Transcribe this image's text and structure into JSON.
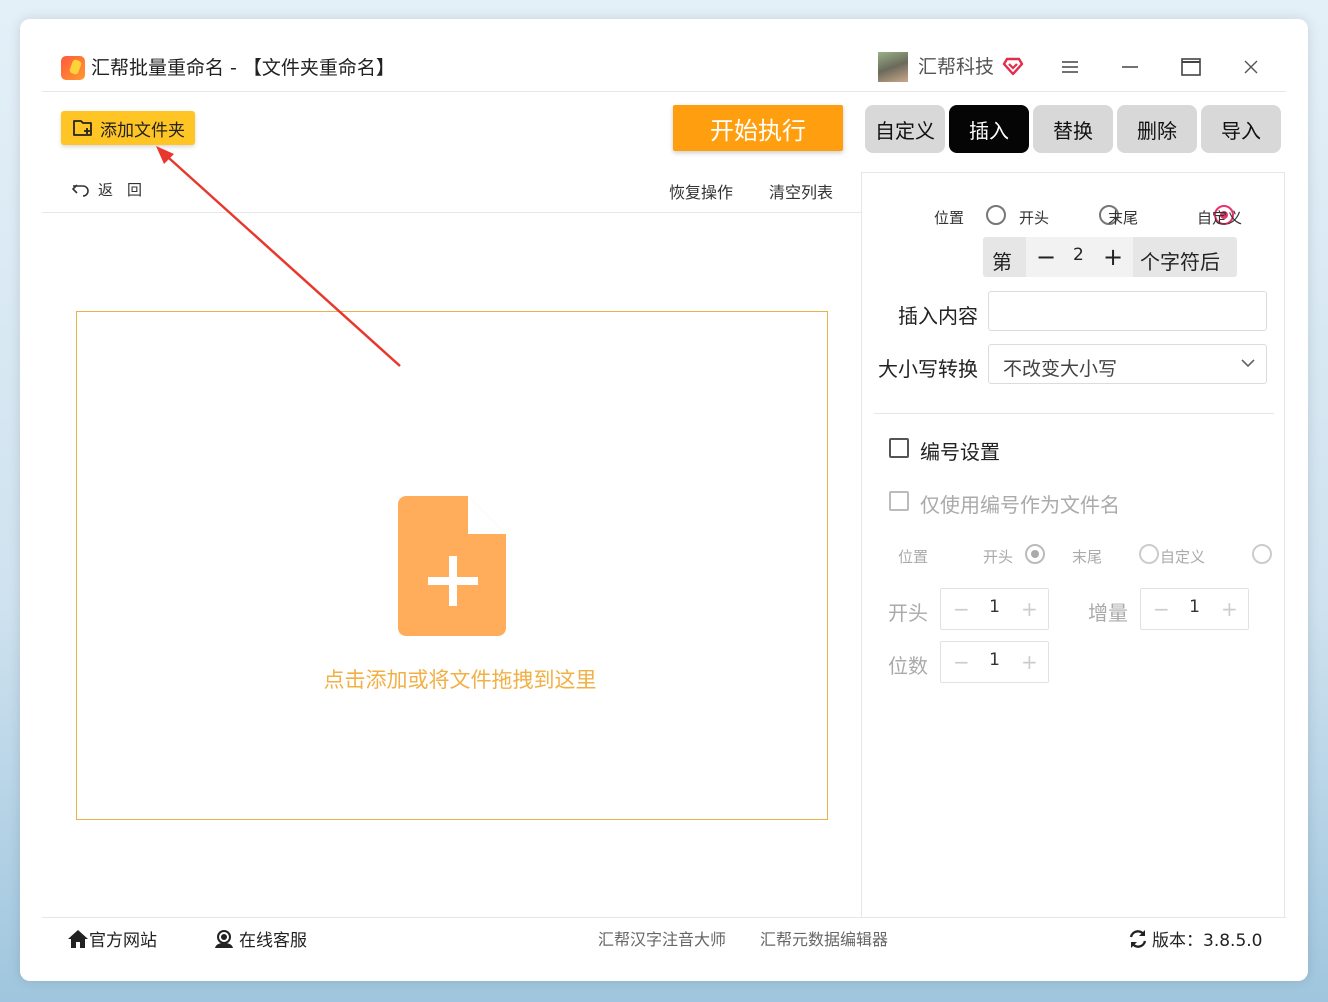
{
  "titlebar": {
    "title": "汇帮批量重命名 - 【文件夹重命名】",
    "brand": "汇帮科技",
    "icons": [
      "app-icon",
      "avatar",
      "vip-heart-icon",
      "menu-icon",
      "minimize-icon",
      "maximize-icon",
      "close-icon"
    ]
  },
  "toolbar": {
    "add_folder": "添加文件夹",
    "start": "开始执行",
    "back": "返回",
    "restore": "恢复操作",
    "clear": "清空列表"
  },
  "dropzone": {
    "text": "点击添加或将文件拖拽到这里"
  },
  "tabs": [
    {
      "label": "自定义",
      "active": false
    },
    {
      "label": "插入",
      "active": true
    },
    {
      "label": "替换",
      "active": false
    },
    {
      "label": "删除",
      "active": false
    },
    {
      "label": "导入",
      "active": false
    }
  ],
  "insert": {
    "position_label": "位置",
    "position_options": [
      "开头",
      "末尾",
      "自定义"
    ],
    "position_selected": "自定义",
    "nth_prefix": "第",
    "nth_value": "2",
    "nth_suffix": "个字符后",
    "content_label": "插入内容",
    "content_value": "",
    "case_label": "大小写转换",
    "case_value": "不改变大小写"
  },
  "numbering": {
    "enable_label": "编号设置",
    "only_number_label": "仅使用编号作为文件名",
    "position_label": "位置",
    "position_options": [
      "开头",
      "末尾",
      "自定义"
    ],
    "position_selected": "开头",
    "start_label": "开头",
    "start_value": "1",
    "increment_label": "增量",
    "increment_value": "1",
    "digits_label": "位数",
    "digits_value": "1"
  },
  "statusbar": {
    "website": "官方网站",
    "service": "在线客服",
    "link1": "汇帮汉字注音大师",
    "link2": "汇帮元数据编辑器",
    "version": "版本：3.8.5.0"
  },
  "colors": {
    "accent_orange": "#ff9f0f",
    "add_button": "#ffc525",
    "drop_border": "#e8b24a",
    "file_icon": "#ffad5a",
    "radio_selected": "#e6336b",
    "active_tab": "#050505"
  }
}
